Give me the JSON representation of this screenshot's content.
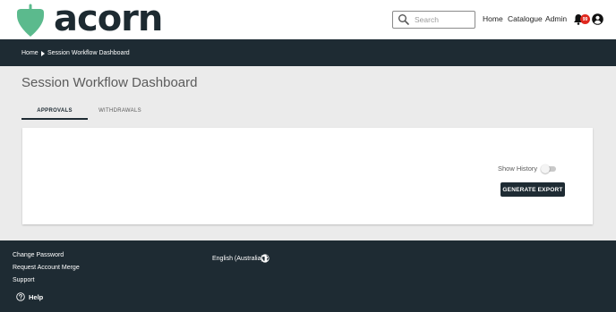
{
  "header": {
    "logo_text": "acorn",
    "search": {
      "placeholder": "Search",
      "value": ""
    },
    "nav": {
      "home": "Home",
      "catalogue": "Catalogue",
      "admin": "Admin"
    },
    "notifications": {
      "count": "99"
    },
    "icons": [
      "acorn-logo-icon",
      "search-icon",
      "bell-icon",
      "user-icon"
    ]
  },
  "breadcrumb": {
    "home": "Home",
    "current": "Session Workflow Dashboard"
  },
  "main": {
    "title": "Session Workflow Dashboard",
    "tabs": [
      {
        "label": "Approvals",
        "active": true
      },
      {
        "label": "Withdrawals",
        "active": false
      }
    ],
    "card": {
      "show_history_label": "Show History",
      "show_history_on": false,
      "export_label": "Generate Export"
    }
  },
  "footer": {
    "links": [
      "Change Password",
      "Request Account Merge",
      "Support"
    ],
    "language": "English (Australia)",
    "help_label": "Help",
    "icons": [
      "globe-icon",
      "help-circle-icon"
    ]
  },
  "colors": {
    "brand_green": "#5bba8d",
    "dark_navy": "#1e2b33",
    "badge_red": "#e0281e",
    "page_bg": "#ebebeb"
  }
}
